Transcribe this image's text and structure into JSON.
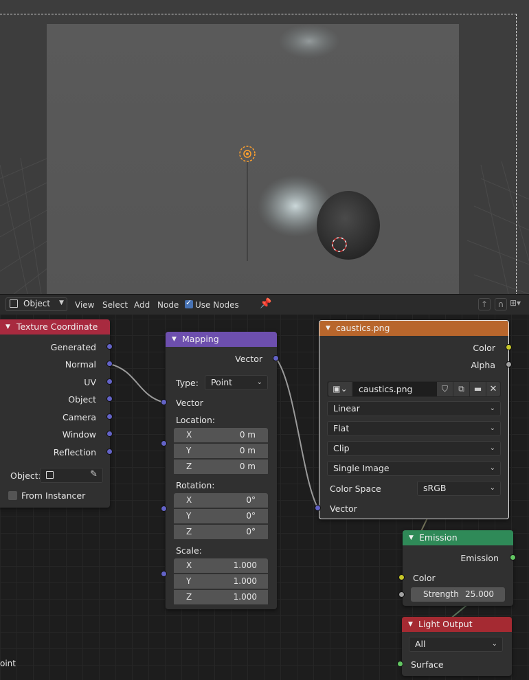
{
  "header": {
    "object_mode": "Object",
    "menu": [
      "View",
      "Select",
      "Add",
      "Node"
    ],
    "use_nodes_label": "Use Nodes",
    "use_nodes_checked": true
  },
  "texture_coordinate": {
    "title": "Texture Coordinate",
    "outputs": [
      "Generated",
      "Normal",
      "UV",
      "Object",
      "Camera",
      "Window",
      "Reflection"
    ],
    "object_label": "Object:",
    "from_instancer_label": "From Instancer",
    "from_instancer_checked": false
  },
  "mapping": {
    "title": "Mapping",
    "output": "Vector",
    "type_label": "Type:",
    "type_value": "Point",
    "vector_label": "Vector",
    "location_label": "Location:",
    "location": [
      {
        "axis": "X",
        "value": "0 m"
      },
      {
        "axis": "Y",
        "value": "0 m"
      },
      {
        "axis": "Z",
        "value": "0 m"
      }
    ],
    "rotation_label": "Rotation:",
    "rotation": [
      {
        "axis": "X",
        "value": "0°"
      },
      {
        "axis": "Y",
        "value": "0°"
      },
      {
        "axis": "Z",
        "value": "0°"
      }
    ],
    "scale_label": "Scale:",
    "scale": [
      {
        "axis": "X",
        "value": "1.000"
      },
      {
        "axis": "Y",
        "value": "1.000"
      },
      {
        "axis": "Z",
        "value": "1.000"
      }
    ]
  },
  "image_texture": {
    "title": "caustics.png",
    "outputs": [
      "Color",
      "Alpha"
    ],
    "image_name": "caustics.png",
    "interpolation": "Linear",
    "projection": "Flat",
    "extension": "Clip",
    "source": "Single Image",
    "color_space_label": "Color Space",
    "color_space": "sRGB",
    "input": "Vector"
  },
  "emission": {
    "title": "Emission",
    "output": "Emission",
    "color_label": "Color",
    "strength_label": "Strength",
    "strength_value": "25.000"
  },
  "light_output": {
    "title": "Light Output",
    "target": "All",
    "surface_label": "Surface"
  },
  "offscreen_fragment": "oint",
  "colors": {
    "texture_coordinate_header": "#a82a3f",
    "mapping_header": "#6d4fae",
    "image_header": "#b8662c",
    "emission_header": "#2f8a58",
    "light_output_header": "#a52a32",
    "vector_socket": "#6363c7",
    "color_socket": "#c7c729",
    "shader_socket": "#63c763"
  }
}
